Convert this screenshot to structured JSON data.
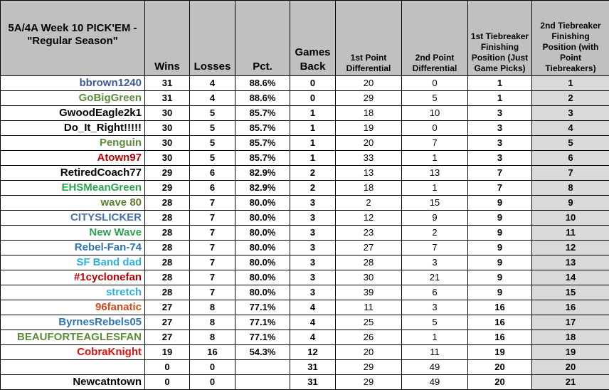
{
  "spreadsheet": {
    "title": "5A/4A Week 10 PICK'EM - \"Regular Season\"",
    "headers": {
      "wins": "Wins",
      "losses": "Losses",
      "pct": "Pct.",
      "games_back": "Games Back",
      "diff1": "1st Point Differential",
      "diff2": "2nd Point Differential",
      "tb1": "1st Tiebreaker Finishing Position (Just Game Picks)",
      "tb2": "2nd Tiebreaker Finishing Position (with Point Tiebreakers)"
    },
    "colors": {
      "header_bg": "#c0c0c0",
      "tb2_bg": "#d9d9d9"
    },
    "rows": [
      {
        "name": "bbrown1240",
        "color": "#3a5a9c",
        "wins": "31",
        "losses": "4",
        "pct": "88.6%",
        "gb": "0",
        "d1": "20",
        "d2": "0",
        "tb1": "1",
        "tb2": "1"
      },
      {
        "name": "GoBigGreen",
        "color": "#5e8a3a",
        "wins": "31",
        "losses": "4",
        "pct": "88.6%",
        "gb": "0",
        "d1": "29",
        "d2": "5",
        "tb1": "1",
        "tb2": "2"
      },
      {
        "name": "GwoodEagle2k1",
        "color": "#000000",
        "wins": "30",
        "losses": "5",
        "pct": "85.7%",
        "gb": "1",
        "d1": "18",
        "d2": "10",
        "tb1": "3",
        "tb2": "3"
      },
      {
        "name": "Do_It_Right!!!!!",
        "color": "#000000",
        "wins": "30",
        "losses": "5",
        "pct": "85.7%",
        "gb": "1",
        "d1": "19",
        "d2": "0",
        "tb1": "3",
        "tb2": "4"
      },
      {
        "name": "Penguin",
        "color": "#5e8a3a",
        "wins": "30",
        "losses": "5",
        "pct": "85.7%",
        "gb": "1",
        "d1": "20",
        "d2": "7",
        "tb1": "3",
        "tb2": "5"
      },
      {
        "name": "Atown97",
        "color": "#c00000",
        "wins": "30",
        "losses": "5",
        "pct": "85.7%",
        "gb": "1",
        "d1": "33",
        "d2": "1",
        "tb1": "3",
        "tb2": "6"
      },
      {
        "name": "RetiredCoach77",
        "color": "#000000",
        "wins": "29",
        "losses": "6",
        "pct": "82.9%",
        "gb": "2",
        "d1": "13",
        "d2": "13",
        "tb1": "7",
        "tb2": "7"
      },
      {
        "name": "EHSMeanGreen",
        "color": "#2aa552",
        "wins": "29",
        "losses": "6",
        "pct": "82.9%",
        "gb": "2",
        "d1": "18",
        "d2": "1",
        "tb1": "7",
        "tb2": "8"
      },
      {
        "name": "wave 80",
        "color": "#5e7a2e",
        "wins": "28",
        "losses": "7",
        "pct": "80.0%",
        "gb": "3",
        "d1": "2",
        "d2": "15",
        "tb1": "9",
        "tb2": "9"
      },
      {
        "name": "CITYSLICKER",
        "color": "#4a72b0",
        "wins": "28",
        "losses": "7",
        "pct": "80.0%",
        "gb": "3",
        "d1": "12",
        "d2": "9",
        "tb1": "9",
        "tb2": "10"
      },
      {
        "name": "New Wave",
        "color": "#2aa552",
        "wins": "28",
        "losses": "7",
        "pct": "80.0%",
        "gb": "3",
        "d1": "23",
        "d2": "2",
        "tb1": "9",
        "tb2": "11"
      },
      {
        "name": "Rebel-Fan-74",
        "color": "#2e74b5",
        "wins": "28",
        "losses": "7",
        "pct": "80.0%",
        "gb": "3",
        "d1": "27",
        "d2": "7",
        "tb1": "9",
        "tb2": "12"
      },
      {
        "name": "SF Band dad",
        "color": "#2fb0e0",
        "wins": "28",
        "losses": "7",
        "pct": "80.0%",
        "gb": "3",
        "d1": "28",
        "d2": "3",
        "tb1": "9",
        "tb2": "13"
      },
      {
        "name": "#1cyclonefan",
        "color": "#c00000",
        "wins": "28",
        "losses": "7",
        "pct": "80.0%",
        "gb": "3",
        "d1": "30",
        "d2": "21",
        "tb1": "9",
        "tb2": "14"
      },
      {
        "name": "stretch",
        "color": "#2fb0e0",
        "wins": "28",
        "losses": "7",
        "pct": "80.0%",
        "gb": "3",
        "d1": "39",
        "d2": "6",
        "tb1": "9",
        "tb2": "15"
      },
      {
        "name": "96fanatic",
        "color": "#d04a1a",
        "wins": "27",
        "losses": "8",
        "pct": "77.1%",
        "gb": "4",
        "d1": "11",
        "d2": "3",
        "tb1": "16",
        "tb2": "16"
      },
      {
        "name": "ByrnesRebels05",
        "color": "#2e74b5",
        "wins": "27",
        "losses": "8",
        "pct": "77.1%",
        "gb": "4",
        "d1": "25",
        "d2": "5",
        "tb1": "16",
        "tb2": "17"
      },
      {
        "name": "BEAUFORTEAGLESFAN",
        "color": "#5e8a3a",
        "wins": "27",
        "losses": "8",
        "pct": "77.1%",
        "gb": "4",
        "d1": "26",
        "d2": "1",
        "tb1": "16",
        "tb2": "18"
      },
      {
        "name": "CobraKnight",
        "color": "#e01010",
        "wins": "19",
        "losses": "16",
        "pct": "54.3%",
        "gb": "12",
        "d1": "20",
        "d2": "11",
        "tb1": "19",
        "tb2": "19"
      },
      {
        "name": "",
        "color": "#000000",
        "wins": "0",
        "losses": "0",
        "pct": "",
        "gb": "31",
        "d1": "29",
        "d2": "49",
        "tb1": "20",
        "tb2": "20"
      },
      {
        "name": "Newcatntown",
        "color": "#000000",
        "wins": "0",
        "losses": "0",
        "pct": "",
        "gb": "31",
        "d1": "29",
        "d2": "49",
        "tb1": "20",
        "tb2": "21"
      }
    ]
  }
}
